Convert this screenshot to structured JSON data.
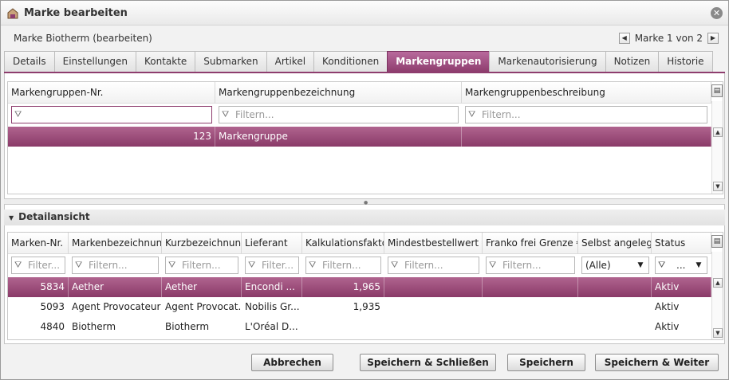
{
  "window": {
    "title": "Marke bearbeiten"
  },
  "header": {
    "subtitle": "Marke Biotherm (bearbeiten)",
    "pager": "Marke 1 von 2"
  },
  "tabs": [
    {
      "label": "Details"
    },
    {
      "label": "Einstellungen"
    },
    {
      "label": "Kontakte"
    },
    {
      "label": "Submarken"
    },
    {
      "label": "Artikel"
    },
    {
      "label": "Konditionen"
    },
    {
      "label": "Markengruppen",
      "active": true
    },
    {
      "label": "Markenautorisierung"
    },
    {
      "label": "Notizen"
    },
    {
      "label": "Historie"
    }
  ],
  "groups_grid": {
    "columns": [
      "Markengruppen-Nr.",
      "Markengruppenbezeichnung",
      "Markengruppenbeschreibung"
    ],
    "filter_placeholders": [
      "",
      "Filtern...",
      "Filtern..."
    ],
    "rows": [
      [
        "123",
        "Markengruppe",
        ""
      ]
    ]
  },
  "detail": {
    "title": "Detailansicht",
    "columns": [
      "Marken-Nr.",
      "Markenbezeichnung",
      "Kurzbezeichnung",
      "Lieferant",
      "Kalkulationsfaktor",
      "Mindestbestellwert €",
      "Franko frei Grenze €",
      "Selbst angelegt",
      "Status"
    ],
    "filter_placeholders": [
      "Filter...",
      "Filtern...",
      "Filtern...",
      "Filter...",
      "Filtern...",
      "Filtern...",
      "Filtern...",
      "(Alle)",
      "..."
    ],
    "rows": [
      [
        "5834",
        "Aether",
        "Aether",
        "Encondi ...",
        "1,965",
        "",
        "",
        "",
        "Aktiv"
      ],
      [
        "5093",
        "Agent Provocateur",
        "Agent Provocat.",
        "Nobilis Gr...",
        "1,935",
        "",
        "",
        "",
        "Aktiv"
      ],
      [
        "4840",
        "Biotherm",
        "Biotherm",
        "L'Oréal D...",
        "",
        "",
        "",
        "",
        "Aktiv"
      ]
    ]
  },
  "buttons": {
    "cancel": "Abbrechen",
    "save_close": "Speichern & Schließen",
    "save": "Speichern",
    "save_next": "Speichern & Weiter"
  },
  "colors": {
    "accent": "#8e3d6e"
  }
}
